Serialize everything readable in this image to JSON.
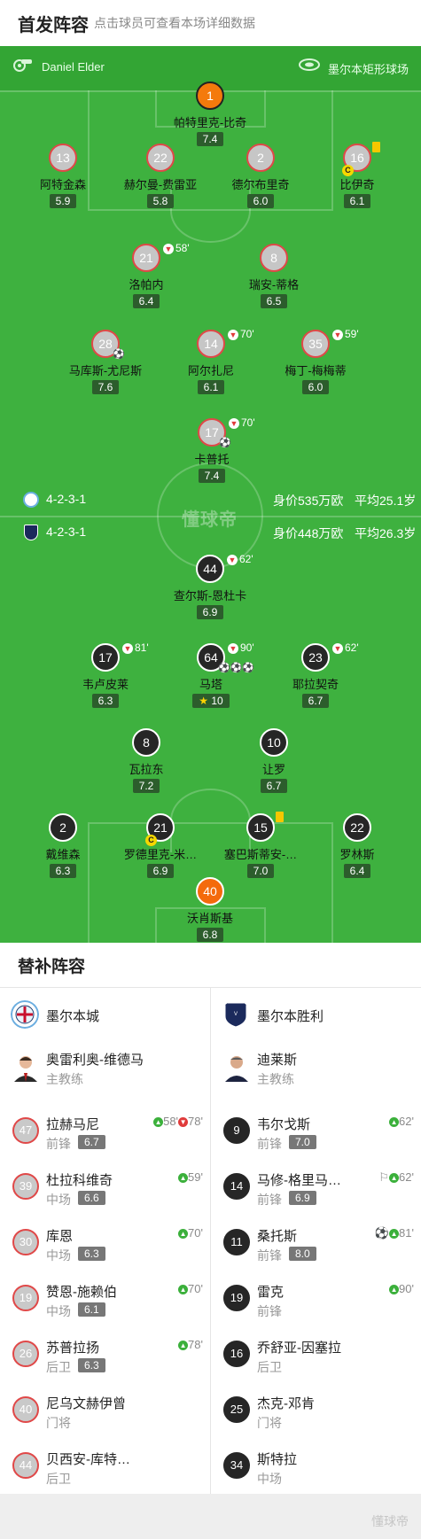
{
  "header": {
    "title": "首发阵容",
    "subtitle": "点击球员可查看本场详细数据"
  },
  "pitch": {
    "referee": "Daniel Elder",
    "venue": "墨尔本矩形球场",
    "watermark": "懂球帝",
    "home_formation": {
      "formation": "4-2-3-1",
      "value": "身价535万欧",
      "age": "平均25.1岁"
    },
    "away_formation": {
      "formation": "4-2-3-1",
      "value": "身价448万欧",
      "age": "平均26.3岁"
    },
    "home_players": [
      {
        "num": "1",
        "name": "帕特里克-比奇",
        "rating": "7.4",
        "gk": true
      },
      {
        "num": "13",
        "name": "阿特金森",
        "rating": "5.9"
      },
      {
        "num": "22",
        "name": "赫尔曼-费雷亚",
        "rating": "5.8"
      },
      {
        "num": "2",
        "name": "德尔布里奇",
        "rating": "6.0"
      },
      {
        "num": "16",
        "name": "比伊奇",
        "rating": "6.1",
        "yellow": true,
        "captain": true
      },
      {
        "num": "21",
        "name": "洛帕内",
        "rating": "6.4",
        "sub": "58'"
      },
      {
        "num": "8",
        "name": "瑞安-蒂格",
        "rating": "6.5"
      },
      {
        "num": "28",
        "name": "马库斯-尤尼斯",
        "rating": "7.6"
      },
      {
        "num": "14",
        "name": "阿尔扎尼",
        "rating": "6.1",
        "sub": "70'"
      },
      {
        "num": "35",
        "name": "梅丁-梅梅蒂",
        "rating": "6.0",
        "sub": "59'"
      },
      {
        "num": "17",
        "name": "卡普托",
        "rating": "7.4",
        "sub": "70'"
      }
    ],
    "away_players": [
      {
        "num": "44",
        "name": "查尔斯-恩杜卡",
        "rating": "6.9",
        "sub": "62'"
      },
      {
        "num": "17",
        "name": "韦卢皮莱",
        "rating": "6.3",
        "sub": "81'"
      },
      {
        "num": "64",
        "name": "马塔",
        "rating": "10",
        "sub": "90'"
      },
      {
        "num": "23",
        "name": "耶拉契奇",
        "rating": "6.7",
        "sub": "62'"
      },
      {
        "num": "8",
        "name": "瓦拉东",
        "rating": "7.2"
      },
      {
        "num": "10",
        "name": "让罗",
        "rating": "6.7"
      },
      {
        "num": "2",
        "name": "戴维森",
        "rating": "6.3"
      },
      {
        "num": "21",
        "name": "罗德里克-米…",
        "rating": "6.9",
        "captain": true
      },
      {
        "num": "15",
        "name": "塞巴斯蒂安-…",
        "rating": "7.0",
        "yellow": true
      },
      {
        "num": "22",
        "name": "罗林斯",
        "rating": "6.4"
      },
      {
        "num": "40",
        "name": "沃肖斯基",
        "rating": "6.8",
        "gk": true
      }
    ]
  },
  "subs": {
    "title": "替补阵容",
    "home": {
      "team": "墨尔本城",
      "coach": {
        "name": "奥雷利奥-维德马",
        "role": "主教练"
      },
      "players": [
        {
          "num": "47",
          "name": "拉赫马尼",
          "pos": "前锋",
          "rating": "6.7",
          "in": "58'",
          "out": "78'"
        },
        {
          "num": "39",
          "name": "杜拉科维奇",
          "pos": "中场",
          "rating": "6.6",
          "in": "59'"
        },
        {
          "num": "30",
          "name": "库恩",
          "pos": "中场",
          "rating": "6.3",
          "in": "70'"
        },
        {
          "num": "19",
          "name": "赞恩-施赖伯",
          "pos": "中场",
          "rating": "6.1",
          "in": "70'"
        },
        {
          "num": "26",
          "name": "苏普拉扬",
          "pos": "后卫",
          "rating": "6.3",
          "in": "78'"
        },
        {
          "num": "40",
          "name": "尼乌文赫伊曾",
          "pos": "门将"
        },
        {
          "num": "44",
          "name": "贝西安-库特…",
          "pos": "后卫"
        }
      ]
    },
    "away": {
      "team": "墨尔本胜利",
      "coach": {
        "name": "迪莱斯",
        "role": "主教练"
      },
      "players": [
        {
          "num": "9",
          "name": "韦尔戈斯",
          "pos": "前锋",
          "rating": "7.0",
          "in": "62'"
        },
        {
          "num": "14",
          "name": "马修-格里马…",
          "pos": "前锋",
          "rating": "6.9",
          "in": "62'"
        },
        {
          "num": "11",
          "name": "桑托斯",
          "pos": "前锋",
          "rating": "8.0",
          "in": "81'"
        },
        {
          "num": "19",
          "name": "雷克",
          "pos": "前锋",
          "in": "90'"
        },
        {
          "num": "16",
          "name": "乔舒亚-因塞拉",
          "pos": "后卫"
        },
        {
          "num": "25",
          "name": "杰克-邓肯",
          "pos": "门将"
        },
        {
          "num": "34",
          "name": "斯特拉",
          "pos": "中场"
        }
      ]
    }
  },
  "footer": {
    "watermark": "懂球帝"
  }
}
